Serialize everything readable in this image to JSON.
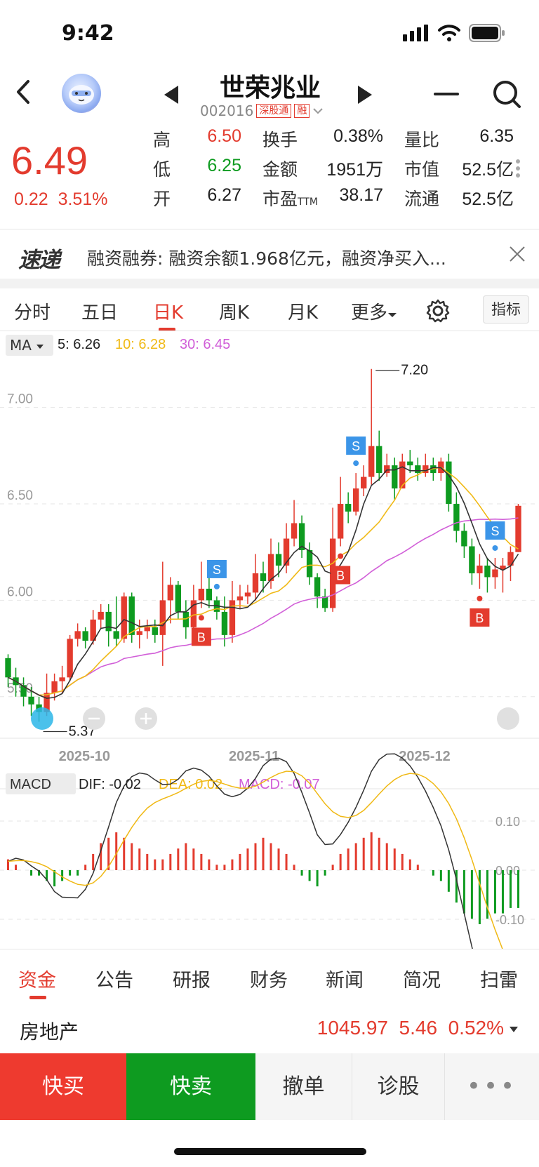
{
  "status": {
    "time": "9:42"
  },
  "header": {
    "name": "世荣兆业",
    "code": "002016",
    "tag1": "深股通",
    "tag2": "融"
  },
  "quote": {
    "price": "6.49",
    "change": "0.22",
    "change_pct": "3.51%",
    "high_label": "高",
    "high": "6.50",
    "low_label": "低",
    "low": "6.25",
    "open_label": "开",
    "open": "6.27",
    "turnover_label": "换手",
    "turnover": "0.38%",
    "amount_label": "金额",
    "amount": "1951万",
    "pe_label": "市盈",
    "pe_suffix": "TTM",
    "pe": "38.17",
    "vol_ratio_label": "量比",
    "vol_ratio": "6.35",
    "mcap_label": "市值",
    "mcap": "52.5亿",
    "float_label": "流通",
    "float": "52.5亿"
  },
  "news": {
    "logo": "速递",
    "text": "融资融券: 融资余额1.968亿元，融资净买入..."
  },
  "tabs": {
    "items": [
      "分时",
      "五日",
      "日K",
      "周K",
      "月K",
      "更多"
    ],
    "indicator": "指标"
  },
  "colors": {
    "up": "#e33b2e",
    "down": "#0e9b20",
    "ma5": "#333333",
    "ma10": "#f0b915",
    "ma30": "#d15fd8"
  },
  "kline": {
    "ma_selector": "MA",
    "ma5_label": "5: 6.26",
    "ma10_label": "10: 6.28",
    "ma30_label": "30: 6.45",
    "y_ticks": [
      "7.00",
      "6.50",
      "6.00",
      "5.50"
    ],
    "x_ticks": [
      "2025-10",
      "2025-11",
      "2025-12"
    ],
    "max_label": "7.20",
    "min_label": "5.37",
    "signal_s": "S",
    "signal_b": "B"
  },
  "macd": {
    "selector": "MACD",
    "dif_label": "DIF: -0.02",
    "dea_label": "DEA: 0.02",
    "macd_label": "MACD: -0.07",
    "y_ticks": [
      "0.10",
      "0.00",
      "-0.10"
    ]
  },
  "chart_data": {
    "type": "candlestick",
    "ylim": [
      5.35,
      7.25
    ],
    "candles": [
      [
        5.7,
        5.6,
        5.72,
        5.55
      ],
      [
        5.6,
        5.56,
        5.65,
        5.5
      ],
      [
        5.56,
        5.5,
        5.6,
        5.45
      ],
      [
        5.5,
        5.46,
        5.55,
        5.4
      ],
      [
        5.46,
        5.42,
        5.5,
        5.37
      ],
      [
        5.42,
        5.52,
        5.62,
        5.4
      ],
      [
        5.52,
        5.58,
        5.62,
        5.48
      ],
      [
        5.58,
        5.6,
        5.66,
        5.52
      ],
      [
        5.6,
        5.8,
        5.82,
        5.58
      ],
      [
        5.8,
        5.84,
        5.88,
        5.76
      ],
      [
        5.84,
        5.79,
        5.86,
        5.75
      ],
      [
        5.79,
        5.9,
        5.95,
        5.77
      ],
      [
        5.9,
        5.94,
        5.98,
        5.85
      ],
      [
        5.94,
        5.84,
        5.98,
        5.76
      ],
      [
        5.84,
        5.8,
        6.02,
        5.76
      ],
      [
        5.8,
        6.02,
        6.04,
        5.78
      ],
      [
        6.02,
        5.82,
        6.04,
        5.78
      ],
      [
        5.82,
        5.84,
        5.9,
        5.75
      ],
      [
        5.84,
        5.86,
        5.9,
        5.8
      ],
      [
        5.86,
        5.82,
        5.9,
        5.78
      ],
      [
        5.82,
        6.0,
        6.2,
        5.66
      ],
      [
        6.0,
        6.08,
        6.12,
        5.88
      ],
      [
        6.08,
        5.94,
        6.1,
        5.9
      ],
      [
        5.94,
        5.86,
        6.0,
        5.8
      ],
      [
        5.86,
        6.0,
        6.08,
        5.82
      ],
      [
        6.0,
        6.06,
        6.2,
        5.96
      ],
      [
        6.06,
        6.0,
        6.12,
        5.96
      ],
      [
        6.0,
        5.94,
        6.02,
        5.9
      ],
      [
        5.94,
        5.82,
        6.02,
        5.76
      ],
      [
        5.82,
        6.0,
        6.1,
        5.78
      ],
      [
        6.0,
        6.02,
        6.08,
        5.96
      ],
      [
        6.02,
        6.04,
        6.08,
        5.98
      ],
      [
        6.04,
        6.14,
        6.24,
        6.0
      ],
      [
        6.14,
        6.1,
        6.2,
        6.04
      ],
      [
        6.1,
        6.24,
        6.32,
        6.06
      ],
      [
        6.24,
        6.18,
        6.3,
        6.12
      ],
      [
        6.18,
        6.32,
        6.4,
        6.14
      ],
      [
        6.32,
        6.4,
        6.52,
        6.28
      ],
      [
        6.4,
        6.26,
        6.44,
        6.22
      ],
      [
        6.26,
        6.12,
        6.3,
        6.08
      ],
      [
        6.12,
        6.02,
        6.14,
        5.96
      ],
      [
        6.02,
        5.96,
        6.06,
        5.94
      ],
      [
        5.96,
        6.32,
        6.48,
        5.94
      ],
      [
        6.32,
        6.5,
        6.64,
        6.28
      ],
      [
        6.5,
        6.46,
        6.56,
        6.4
      ],
      [
        6.46,
        6.58,
        6.66,
        6.44
      ],
      [
        6.58,
        6.64,
        6.7,
        6.54
      ],
      [
        6.64,
        6.8,
        7.2,
        6.6
      ],
      [
        6.8,
        6.66,
        6.88,
        6.62
      ],
      [
        6.66,
        6.7,
        6.76,
        6.64
      ],
      [
        6.7,
        6.58,
        6.74,
        6.52
      ],
      [
        6.58,
        6.72,
        6.76,
        6.6
      ],
      [
        6.72,
        6.7,
        6.78,
        6.66
      ],
      [
        6.7,
        6.66,
        6.74,
        6.62
      ],
      [
        6.66,
        6.7,
        6.76,
        6.64
      ],
      [
        6.7,
        6.66,
        6.74,
        6.62
      ],
      [
        6.66,
        6.72,
        6.74,
        6.62
      ],
      [
        6.72,
        6.5,
        6.76,
        6.46
      ],
      [
        6.5,
        6.36,
        6.56,
        6.3
      ],
      [
        6.36,
        6.28,
        6.4,
        6.22
      ],
      [
        6.28,
        6.14,
        6.32,
        6.08
      ],
      [
        6.14,
        6.18,
        6.24,
        6.06
      ],
      [
        6.18,
        6.12,
        6.22,
        6.04
      ],
      [
        6.12,
        6.16,
        6.22,
        6.06
      ],
      [
        6.16,
        6.18,
        6.22,
        6.04
      ],
      [
        6.18,
        6.25,
        6.28,
        6.1
      ],
      [
        6.25,
        6.49,
        6.5,
        6.25
      ]
    ],
    "macd_hist": [
      0.02,
      0.01,
      0.0,
      -0.01,
      -0.01,
      -0.02,
      -0.03,
      -0.02,
      -0.01,
      -0.01,
      0.01,
      0.03,
      0.05,
      0.06,
      0.07,
      0.06,
      0.05,
      0.04,
      0.03,
      0.02,
      0.02,
      0.03,
      0.04,
      0.05,
      0.04,
      0.03,
      0.02,
      0.01,
      0.01,
      0.02,
      0.03,
      0.04,
      0.05,
      0.06,
      0.05,
      0.04,
      0.03,
      0.01,
      -0.01,
      -0.02,
      -0.03,
      -0.01,
      0.01,
      0.03,
      0.04,
      0.05,
      0.06,
      0.07,
      0.06,
      0.05,
      0.04,
      0.03,
      0.02,
      0.01,
      0.0,
      -0.01,
      -0.02,
      -0.04,
      -0.06,
      -0.08,
      -0.09,
      -0.1,
      -0.09,
      -0.08,
      -0.08,
      -0.07,
      -0.07
    ]
  },
  "bottom_tabs": [
    "资金",
    "公告",
    "研报",
    "财务",
    "新闻",
    "简况",
    "扫雷"
  ],
  "sector": {
    "name": "房地产",
    "value": "1045.97",
    "change": "5.46",
    "change_pct": "0.52%"
  },
  "actions": {
    "buy": "快买",
    "sell": "快卖",
    "cancel": "撤单",
    "diagnose": "诊股",
    "more": "•••"
  }
}
